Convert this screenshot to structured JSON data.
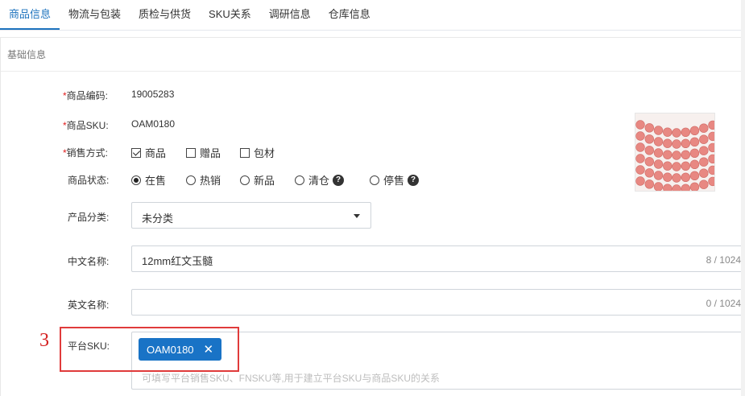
{
  "tabs": [
    {
      "label": "商品信息"
    },
    {
      "label": "物流与包装"
    },
    {
      "label": "质检与供货"
    },
    {
      "label": "SKU关系"
    },
    {
      "label": "调研信息"
    },
    {
      "label": "仓库信息"
    }
  ],
  "section": {
    "title": "基础信息"
  },
  "form": {
    "code": {
      "required_mark": "*",
      "label": "商品编码:",
      "value": "19005283"
    },
    "sku": {
      "required_mark": "*",
      "label": "商品SKU:",
      "value": "OAM0180"
    },
    "sale_method": {
      "required_mark": "*",
      "label": "销售方式:",
      "options": [
        {
          "label": "商品",
          "checked": true
        },
        {
          "label": "赠品",
          "checked": false
        },
        {
          "label": "包材",
          "checked": false
        }
      ]
    },
    "status": {
      "label": "商品状态:",
      "help_glyph": "?",
      "options": [
        {
          "label": "在售",
          "checked": true
        },
        {
          "label": "热销",
          "checked": false
        },
        {
          "label": "新品",
          "checked": false
        },
        {
          "label": "清仓",
          "checked": false
        },
        {
          "label": "停售",
          "checked": false
        }
      ]
    },
    "category": {
      "label": "产品分类:",
      "value": "未分类"
    },
    "cn_name": {
      "label": "中文名称:",
      "value": "12mm红文玉髓",
      "count": "8 / 1024"
    },
    "en_name": {
      "label": "英文名称:",
      "value": "",
      "count": "0 / 1024"
    },
    "platform_sku": {
      "label": "平台SKU:",
      "tag": "OAM0180",
      "tag_remove": "✕",
      "placeholder": "可填写平台销售SKU、FNSKU等,用于建立平台SKU与商品SKU的关系"
    }
  },
  "annotation": {
    "marker": "3",
    "color": "#e03b3b"
  },
  "colors": {
    "accent": "#1e73be",
    "chip": "#1973c6",
    "required": "#e02020",
    "bead": "#e88882"
  }
}
